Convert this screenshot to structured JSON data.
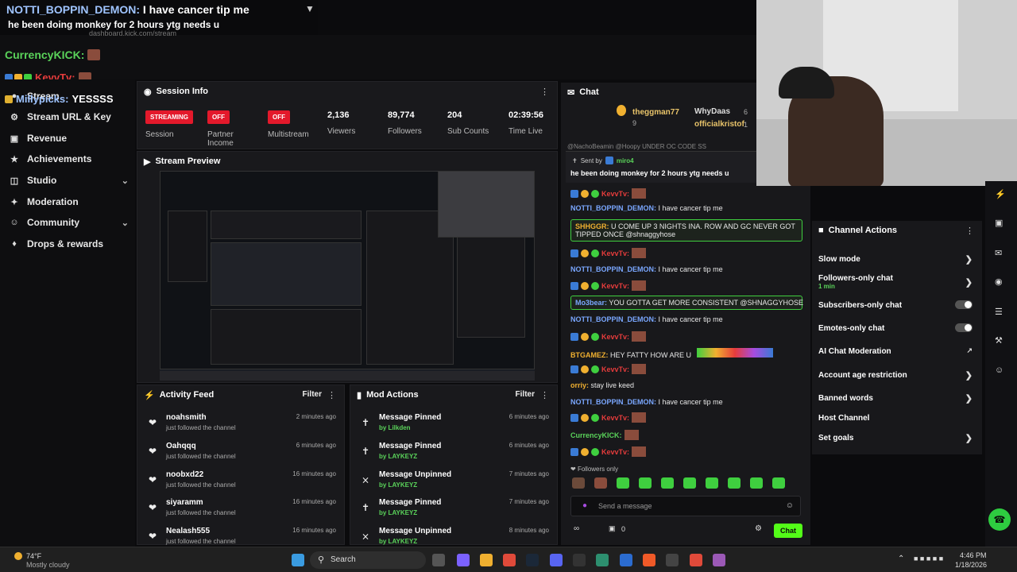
{
  "overlay": {
    "line1_name": "NOTTI_BOPPIN_DEMON:",
    "line1_text": "I have cancer tip me",
    "line2_text": "he been doing monkey for 2 hours ytg needs u",
    "url_ghost": "dashboard.kick.com/stream",
    "chat1_name": "CurrencyKICK:",
    "chat2_name": "KevvTv:",
    "chat3_name": "Millypicks:",
    "chat3_text": "YESSSS"
  },
  "sidebar": {
    "items": [
      {
        "label": "Stream",
        "icon": "broadcast-icon"
      },
      {
        "label": "Stream URL & Key",
        "icon": "key-icon"
      },
      {
        "label": "Revenue",
        "icon": "revenue-icon"
      },
      {
        "label": "Achievements",
        "icon": "achievement-icon"
      },
      {
        "label": "Studio",
        "icon": "studio-icon",
        "chevron": "⌄"
      },
      {
        "label": "Moderation",
        "icon": "wrench-icon"
      },
      {
        "label": "Community",
        "icon": "community-icon",
        "chevron": "⌄"
      },
      {
        "label": "Drops & rewards",
        "icon": "gift-icon"
      }
    ]
  },
  "session": {
    "title": "Session Info",
    "session_badge": "STREAMING",
    "session_label": "Session",
    "partner_badge": "OFF",
    "partner_label": "Partner Income",
    "multi_badge": "OFF",
    "multi_label": "Multistream",
    "viewers": "2,136",
    "viewers_label": "Viewers",
    "followers": "89,774",
    "followers_label": "Followers",
    "subs": "204",
    "subs_label": "Sub Counts",
    "time": "02:39:56",
    "time_label": "Time Live"
  },
  "preview": {
    "title": "Stream Preview"
  },
  "activity": {
    "title": "Activity Feed",
    "filter": "Filter",
    "rows": [
      {
        "name": "noahsmith",
        "sub": "just followed the channel",
        "time": "2 minutes ago"
      },
      {
        "name": "Oahqqq",
        "sub": "just followed the channel",
        "time": "6 minutes ago"
      },
      {
        "name": "noobxd22",
        "sub": "just followed the channel",
        "time": "16 minutes ago"
      },
      {
        "name": "siyaramm",
        "sub": "just followed the channel",
        "time": "16 minutes ago"
      },
      {
        "name": "Nealash555",
        "sub": "just followed the channel",
        "time": "16 minutes ago"
      }
    ]
  },
  "mod": {
    "title": "Mod Actions",
    "filter": "Filter",
    "rows": [
      {
        "name": "Message Pinned",
        "sub": "by Lilkden",
        "time": "6 minutes ago"
      },
      {
        "name": "Message Pinned",
        "sub": "by LAYKEYZ",
        "time": "6 minutes ago"
      },
      {
        "name": "Message Unpinned",
        "sub": "by LAYKEYZ",
        "time": "7 minutes ago"
      },
      {
        "name": "Message Pinned",
        "sub": "by LAYKEYZ",
        "time": "7 minutes ago"
      },
      {
        "name": "Message Unpinned",
        "sub": "by LAYKEYZ",
        "time": "8 minutes ago"
      }
    ]
  },
  "chat": {
    "title": "Chat",
    "top_user1": "theggman77",
    "top_user2": "WhyDaas",
    "top_user3": "officialkristof",
    "top_num1": "9",
    "top_num2": "6",
    "top_num3": "1",
    "partial_line": "@NachoBeamin @Hoopy UNDER OC CODE SS",
    "pinned_sent_by": "Sent by",
    "pinned_user": "miro4",
    "pinned_text": "he been doing monkey for 2 hours ytg needs u",
    "messages": [
      {
        "user": "KevvTv:",
        "text": "",
        "kind": "kick"
      },
      {
        "user": "NOTTI_BOPPIN_DEMON:",
        "text": "I have cancer tip me",
        "kind": "plain"
      },
      {
        "user": "SHHGGR:",
        "text": "U COME UP 3 NIGHTS INA. ROW AND GC NEVER GOT TIPPED ONCE @shnaggyhose",
        "kind": "hl"
      },
      {
        "user": "KevvTv:",
        "text": "",
        "kind": "kick"
      },
      {
        "user": "NOTTI_BOPPIN_DEMON:",
        "text": "I have cancer tip me",
        "kind": "plain"
      },
      {
        "user": "KevvTv:",
        "text": "",
        "kind": "kick"
      },
      {
        "user": "Mo3bear:",
        "text": "YOU GOTTA GET MORE CONSISTENT @SHNAGGYHOSE",
        "kind": "hl"
      },
      {
        "user": "NOTTI_BOPPIN_DEMON:",
        "text": "I have cancer tip me",
        "kind": "plain"
      },
      {
        "user": "KevvTv:",
        "text": "",
        "kind": "kick"
      },
      {
        "user": "BTGAMEZ:",
        "text": "HEY FATTY HOW ARE U",
        "kind": "plain"
      },
      {
        "user": "KevvTv:",
        "text": "",
        "kind": "kick"
      },
      {
        "user": "orriy:",
        "text": "stay live keed",
        "kind": "plain"
      },
      {
        "user": "NOTTI_BOPPIN_DEMON:",
        "text": "I have cancer tip me",
        "kind": "plain"
      },
      {
        "user": "KevvTv:",
        "text": "",
        "kind": "kick"
      },
      {
        "user": "CurrencyKICK:",
        "text": "",
        "kind": "plain"
      },
      {
        "user": "KevvTv:",
        "text": "",
        "kind": "kick"
      }
    ],
    "followers_only": "Followers only",
    "placeholder": "Send a message",
    "count": "0",
    "send": "Chat"
  },
  "channel": {
    "title": "Channel Actions",
    "items": [
      {
        "label": "Slow mode",
        "type": "arrow"
      },
      {
        "label": "Followers-only chat",
        "sub": "1 min",
        "type": "arrow"
      },
      {
        "label": "Subscribers-only chat",
        "type": "toggle"
      },
      {
        "label": "Emotes-only chat",
        "type": "toggle"
      },
      {
        "label": "AI Chat Moderation",
        "type": "ext"
      },
      {
        "label": "Account age restriction",
        "type": "arrow"
      },
      {
        "label": "Banned words",
        "type": "arrow"
      },
      {
        "label": "Host Channel",
        "type": "none"
      },
      {
        "label": "Set goals",
        "type": "arrow"
      }
    ]
  },
  "taskbar": {
    "weather_temp": "74°F",
    "weather_desc": "Mostly cloudy",
    "search": "Search",
    "time": "4:46 PM",
    "date": "1/18/2026"
  },
  "colors": {
    "kick_green": "#53fc18",
    "live_red": "#e3192b"
  }
}
